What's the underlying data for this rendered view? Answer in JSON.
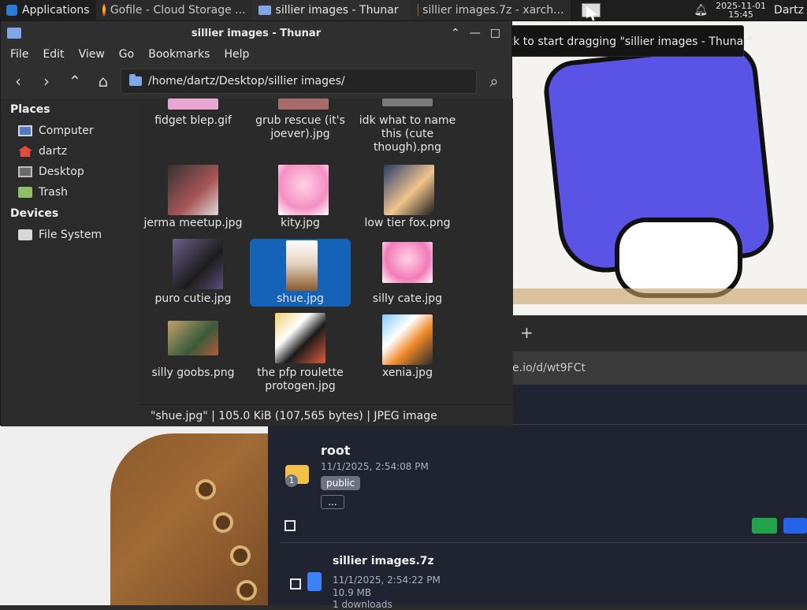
{
  "taskbar": {
    "apps_label": "Applications",
    "tasks": [
      {
        "label": "Gofile - Cloud Storage ..."
      },
      {
        "label": "sillier images - Thunar"
      },
      {
        "label": "sillier images.7z - xarch..."
      }
    ],
    "clock_date": "2025-11-01",
    "clock_time": "15:45",
    "user": "Dartz"
  },
  "tooltip": "Click to start dragging \"sillier images - Thunar\"",
  "thunar": {
    "title": "sillier images - Thunar",
    "menu": [
      "File",
      "Edit",
      "View",
      "Go",
      "Bookmarks",
      "Help"
    ],
    "path": "/home/dartz/Desktop/sillier images/",
    "sidebar": {
      "places_header": "Places",
      "places": [
        "Computer",
        "dartz",
        "Desktop",
        "Trash"
      ],
      "devices_header": "Devices",
      "devices": [
        "File System"
      ]
    },
    "files": [
      {
        "name": "fidget blep.gif"
      },
      {
        "name": "grub rescue (it's joever).jpg"
      },
      {
        "name": "idk what to name this (cute though).png"
      },
      {
        "name": "jerma meetup.jpg"
      },
      {
        "name": "kity.jpg"
      },
      {
        "name": "low tier fox.png"
      },
      {
        "name": "puro cutie.jpg"
      },
      {
        "name": "shue.jpg"
      },
      {
        "name": "silly cate.jpg"
      },
      {
        "name": "silly goobs.png"
      },
      {
        "name": "the pfp roulette protogen.jpg"
      },
      {
        "name": "xenia.jpg"
      }
    ],
    "status": "\"shue.jpg\"  |  105.0 KiB (107,565 bytes)  |  JPEG image"
  },
  "browser": {
    "url_fragment": "e.io/d/wt9FCt",
    "plus": "+"
  },
  "gofile": {
    "root": {
      "title": "root",
      "time": "11/1/2025, 2:54:08 PM",
      "badge": "public",
      "more": "...",
      "count": "1"
    },
    "file": {
      "title": "sillier images.7z",
      "time": "11/1/2025, 2:54:22 PM",
      "size": "10.9 MB",
      "downloads": "1 downloads"
    }
  },
  "colors": {
    "selection": "#1463b8",
    "share": "#22a34a",
    "add": "#2563eb"
  }
}
